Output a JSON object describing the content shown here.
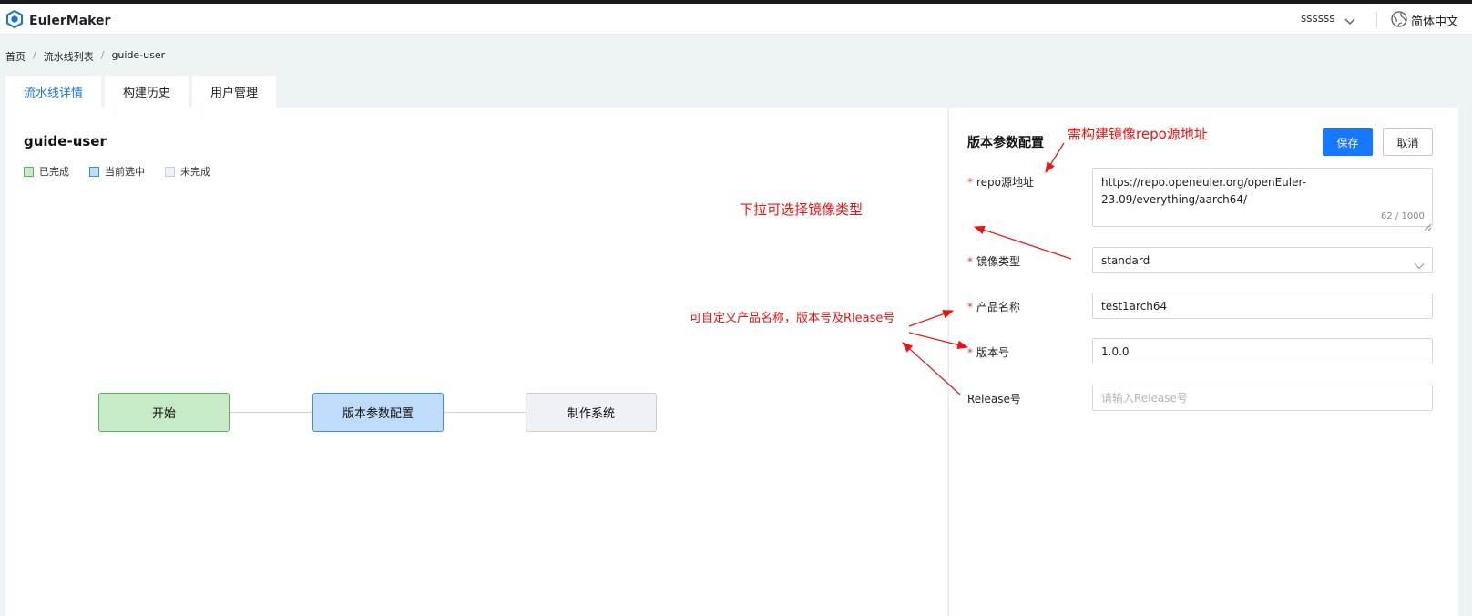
{
  "header": {
    "app_name": "EulerMaker",
    "username": "ssssss",
    "language": "简体中文"
  },
  "breadcrumb": [
    "首页",
    "流水线列表",
    "guide-user"
  ],
  "breadcrumb_separator": "/",
  "tabs": [
    {
      "label": "流水线详情",
      "active": true
    },
    {
      "label": "构建历史",
      "active": false
    },
    {
      "label": "用户管理",
      "active": false
    }
  ],
  "pipeline": {
    "name": "guide-user",
    "legend": [
      {
        "label": "已完成",
        "color": "#c7ebc7",
        "border": "#5ab55a"
      },
      {
        "label": "当前选中",
        "color": "#bfdcfa",
        "border": "#3e8ee8"
      },
      {
        "label": "未完成",
        "color": "#eef1f5",
        "border": "#c6ced8"
      }
    ],
    "nodes": [
      {
        "label": "开始",
        "state": "done"
      },
      {
        "label": "版本参数配置",
        "state": "selected"
      },
      {
        "label": "制作系统",
        "state": "todo"
      }
    ]
  },
  "panel": {
    "title": "版本参数配置",
    "save_label": "保存",
    "cancel_label": "取消",
    "fields": {
      "repo": {
        "label": "repo源地址",
        "required": true,
        "value": "https://repo.openeuler.org/openEuler-23.09/everything/aarch64/",
        "counter": "62 / 1000"
      },
      "image_type": {
        "label": "镜像类型",
        "required": true,
        "value": "standard"
      },
      "product_name": {
        "label": "产品名称",
        "required": true,
        "value": "test1arch64"
      },
      "version": {
        "label": "版本号",
        "required": true,
        "value": "1.0.0"
      },
      "release": {
        "label": "Release号",
        "required": false,
        "value": "",
        "placeholder": "请输入Release号"
      }
    }
  },
  "annotations": {
    "repo_note": "需构建镜像repo源地址",
    "dropdown_note": "下拉可选择镜像类型",
    "custom_note": "可自定义产品名称，版本号及Rlease号"
  },
  "required_mark": "*",
  "colors": {
    "accent": "#1677ff",
    "annotation": "#ee1111",
    "required": "#e53935"
  }
}
